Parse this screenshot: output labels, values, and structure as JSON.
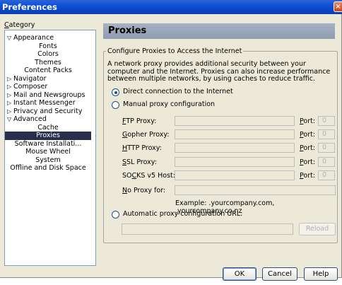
{
  "window": {
    "title": "Preferences",
    "close_glyph": "×"
  },
  "category": {
    "label": "Category",
    "items": [
      {
        "label": "Appearance",
        "level": 0,
        "twisty": "open"
      },
      {
        "label": "Fonts",
        "level": 1
      },
      {
        "label": "Colors",
        "level": 1
      },
      {
        "label": "Themes",
        "level": 1
      },
      {
        "label": "Content Packs",
        "level": 1
      },
      {
        "label": "Navigator",
        "level": 0,
        "twisty": "closed"
      },
      {
        "label": "Composer",
        "level": 0,
        "twisty": "closed"
      },
      {
        "label": "Mail and Newsgroups",
        "level": 0,
        "twisty": "closed"
      },
      {
        "label": "Instant Messenger",
        "level": 0,
        "twisty": "closed"
      },
      {
        "label": "Privacy and Security",
        "level": 0,
        "twisty": "closed"
      },
      {
        "label": "Advanced",
        "level": 0,
        "twisty": "open"
      },
      {
        "label": "Cache",
        "level": 1
      },
      {
        "label": "Proxies",
        "level": 1,
        "selected": true
      },
      {
        "label": "Software Installati...",
        "level": 1
      },
      {
        "label": "Mouse Wheel",
        "level": 1
      },
      {
        "label": "System",
        "level": 1
      },
      {
        "label": "Offline and Disk Space",
        "level": 1
      }
    ]
  },
  "panel": {
    "title": "Proxies",
    "group_title": "Configure Proxies to Access the Internet",
    "description": "A network proxy provides additional security between your computer and the Internet. Proxies can also increase performance between multiple networks, by using caches to reduce traffic.",
    "direct_label": "Direct connection to the Internet",
    "manual_label": "Manual proxy configuration",
    "selected_option": "direct",
    "proxies": [
      {
        "label": "FTP Proxy:",
        "port_label": "Port:",
        "port_value": "0"
      },
      {
        "label": "Gopher Proxy:",
        "port_label": "Port:",
        "port_value": "0"
      },
      {
        "label": "HTTP Proxy:",
        "port_label": "Port:",
        "port_value": "0"
      },
      {
        "label": "SSL Proxy:",
        "port_label": "Port:",
        "port_value": "0"
      },
      {
        "label": "SOCKS v5 Host:",
        "port_label": "Port:",
        "port_value": "0"
      }
    ],
    "no_proxy_label": "No Proxy for:",
    "no_proxy_example": "Example: .yourcompany.com, .yourcompany.co.nz",
    "auto_label": "Automatic proxy configuration URL:",
    "reload_label": "Reload"
  },
  "footer": {
    "ok_label": "OK",
    "cancel_label": "Cancel",
    "help_label": "Help"
  }
}
